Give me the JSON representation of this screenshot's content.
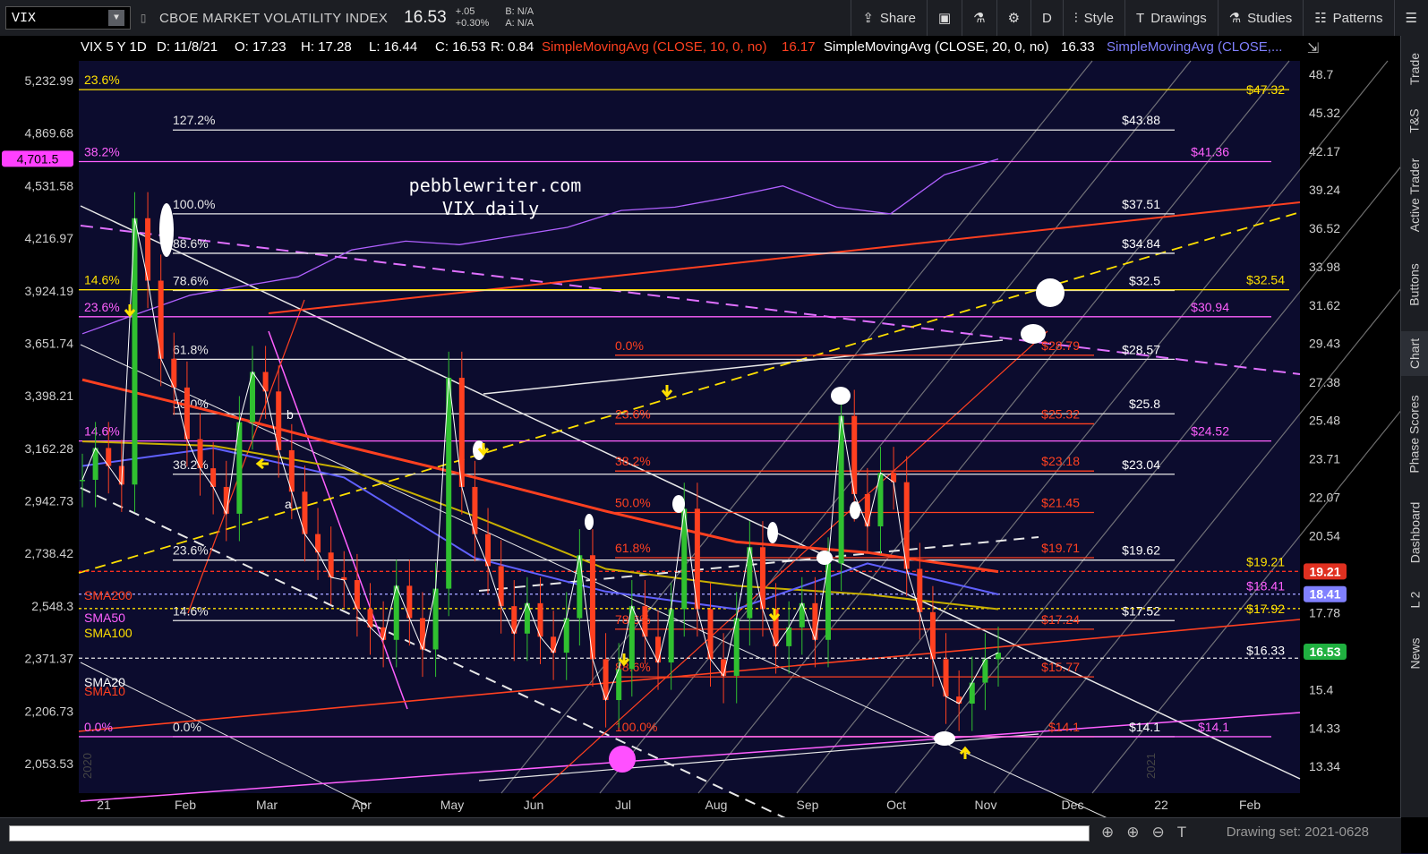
{
  "toolbar": {
    "symbol": "VIX",
    "name": "CBOE MARKET VOLATILITY INDEX",
    "last": "16.53",
    "change": "+.05",
    "change_pct": "+0.30%",
    "bid": "B: N/A",
    "ask": "A: N/A",
    "buttons": {
      "share": "Share",
      "period": "D",
      "style": "Style",
      "drawings": "Drawings",
      "studies": "Studies",
      "patterns": "Patterns"
    }
  },
  "header": {
    "title": "VIX 5 Y 1D",
    "date": "D: 11/8/21",
    "open": "O: 17.23",
    "high": "H: 17.28",
    "low": "L: 16.44",
    "close": "C: 16.53",
    "range": "R: 0.84",
    "sma10": "SimpleMovingAvg (CLOSE, 10, 0, no)",
    "sma10_val": "16.17",
    "sma20": "SimpleMovingAvg (CLOSE, 20, 0, no)",
    "sma20_val": "16.33",
    "sma_other": "SimpleMovingAvg (CLOSE,..."
  },
  "watermark": {
    "line1": "pebblewriter.com",
    "line2": "VIX daily"
  },
  "right_tabs": [
    "Trade",
    "T&S",
    "Active Trader",
    "Buttons",
    "Chart",
    "Phase Scores",
    "Dashboard",
    "L 2",
    "News"
  ],
  "status": {
    "drawing_set": "Drawing set: 2021-0628"
  },
  "chart_data": {
    "type": "line",
    "title": "VIX 5 Y 1D",
    "x_tick_labels": [
      "21",
      "Feb",
      "Mar",
      "Apr",
      "May",
      "Jun",
      "Jul",
      "Aug",
      "Sep",
      "Oct",
      "Nov",
      "Dec",
      "22",
      "Feb"
    ],
    "y_right_ticks": [
      48.7,
      45.32,
      42.17,
      39.24,
      36.52,
      33.98,
      31.62,
      29.43,
      27.38,
      25.48,
      23.71,
      22.07,
      20.54,
      19.11,
      17.78,
      16.55,
      15.4,
      14.33,
      13.34
    ],
    "y_right_scale": "log",
    "y_left_ticks": [
      "5,232.99",
      "4,869.68",
      "4,531.58",
      "4,216.97",
      "3,924.19",
      "3,651.74",
      "3,398.21",
      "3,162.28",
      "2,942.73",
      "2,738.42",
      "2,548.3",
      "2,371.37",
      "2,206.73",
      "2,053.53"
    ],
    "left_badge": "4,701.5",
    "right_badges": [
      {
        "value": "19.21",
        "color": "#e03020"
      },
      {
        "value": "18.41",
        "color": "#8080ff"
      },
      {
        "value": "16.53",
        "color": "#20b040"
      }
    ],
    "series": [
      {
        "name": "VIX",
        "values": [
          22.8,
          24.2,
          23.4,
          22.6,
          37.2,
          33.1,
          28.6,
          27.1,
          24.6,
          23.3,
          22.5,
          21.4,
          25.4,
          27.9,
          26.9,
          24.1,
          22.3,
          20.6,
          19.9,
          19.0,
          18.9,
          17.9,
          17.3,
          16.9,
          18.7,
          17.6,
          16.6,
          18.6,
          27.6,
          22.5,
          20.6,
          19.4,
          18.0,
          17.1,
          18.1,
          17.0,
          16.5,
          17.6,
          19.8,
          16.3,
          15.1,
          16.0,
          18.0,
          17.0,
          16.2,
          17.9,
          21.6,
          17.9,
          16.3,
          15.8,
          17.6,
          20.1,
          17.9,
          16.7,
          17.3,
          18.1,
          16.9,
          19.5,
          25.7,
          22.2,
          20.9,
          23.1,
          22.7,
          19.3,
          17.8,
          16.3,
          15.2,
          15.0,
          15.6,
          16.3,
          16.5
        ]
      },
      {
        "name": "SMA200",
        "values": [
          27.5,
          25.9,
          24.3,
          22.9,
          21.5,
          20.3,
          19.9,
          19.2
        ]
      },
      {
        "name": "SMA100",
        "values": [
          24.5,
          24.3,
          23.3,
          21.3,
          19.3,
          18.7,
          18.4,
          17.9
        ]
      },
      {
        "name": "SMA50",
        "values": [
          23.4,
          24.2,
          22.9,
          19.7,
          18.5,
          17.9,
          19.5,
          18.4
        ]
      },
      {
        "name": "SPX",
        "values": [
          3700,
          3800,
          3900,
          3950,
          4000,
          4150,
          4200,
          4180,
          4230,
          4280,
          4380,
          4400,
          4460,
          4530,
          4400,
          4360,
          4600,
          4700
        ]
      }
    ],
    "sma_labels": [
      "SMA200",
      "SMA50",
      "SMA100",
      "SMA20",
      "SMA10"
    ],
    "fib_white": [
      "127.2%",
      "100.0%",
      "88.6%",
      "78.6%",
      "61.8%",
      "50.0%",
      "38.2%",
      "23.6%",
      "14.6%",
      "0.0%"
    ],
    "fib_white_values": [
      "$43.88",
      "$37.51",
      "$34.84",
      "$32.5",
      "$28.57",
      "$25.8",
      "$23.04",
      "$19.62",
      "$17.52",
      "$16.33",
      "$14.1"
    ],
    "fib_red": [
      "0.0%",
      "23.6%",
      "38.2%",
      "50.0%",
      "61.8%",
      "78.6%",
      "88.6%",
      "100.0%"
    ],
    "fib_red_values": [
      "$28.79",
      "$25.32",
      "$23.18",
      "$21.45",
      "$19.71",
      "$17.24",
      "$15.77",
      "$14.1"
    ],
    "fib_magenta": [
      "38.2%",
      "23.6%",
      "14.6%",
      "0.0%"
    ],
    "fib_magenta_values": [
      "$41.36",
      "$30.94",
      "$24.52",
      "$18.41",
      "$14.1"
    ],
    "fib_yellow": [
      "23.6%",
      "14.6%"
    ],
    "fib_yellow_values": [
      "$47.32",
      "$32.54",
      "$19.21",
      "$17.92"
    ],
    "wave_labels": [
      "a",
      "b"
    ],
    "grid": false,
    "legend": "top-left"
  }
}
